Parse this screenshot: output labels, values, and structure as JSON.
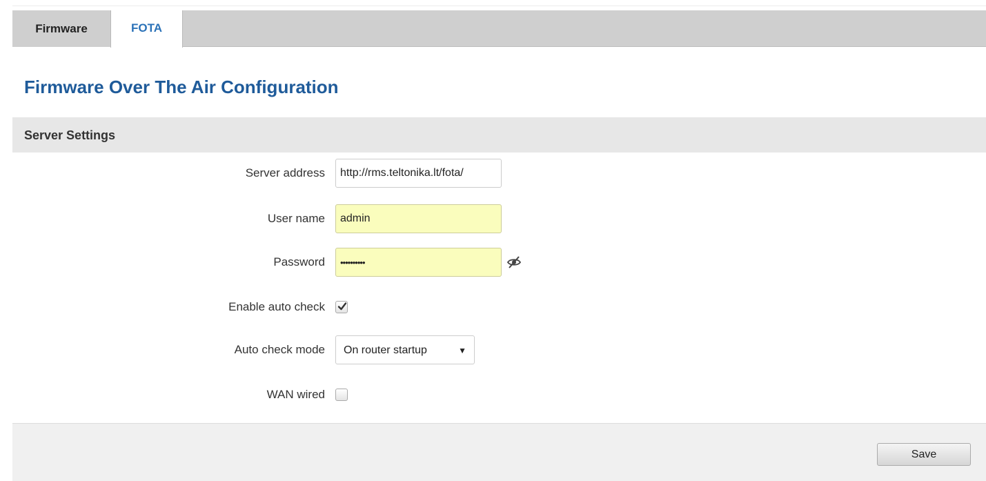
{
  "tabs": [
    {
      "label": "Firmware",
      "active": false
    },
    {
      "label": "FOTA",
      "active": true
    }
  ],
  "page_title": "Firmware Over The Air Configuration",
  "section": {
    "title": "Server Settings"
  },
  "form": {
    "server_address": {
      "label": "Server address",
      "value": "http://rms.teltonika.lt/fota/"
    },
    "user_name": {
      "label": "User name",
      "value": "admin"
    },
    "password": {
      "label": "Password",
      "value": "••••••••••",
      "reveal_icon": "eye-slash-icon"
    },
    "enable_auto_check": {
      "label": "Enable auto check",
      "checked": true
    },
    "auto_check_mode": {
      "label": "Auto check mode",
      "selected": "On router startup"
    },
    "wan_wired": {
      "label": "WAN wired",
      "checked": false
    }
  },
  "footer": {
    "save_label": "Save"
  },
  "colors": {
    "accent": "#2b72b8",
    "title": "#1f5b9a",
    "tabbar_bg": "#cfcfcf",
    "section_bg": "#e7e7e7",
    "autofill_bg": "#fafdbd"
  }
}
